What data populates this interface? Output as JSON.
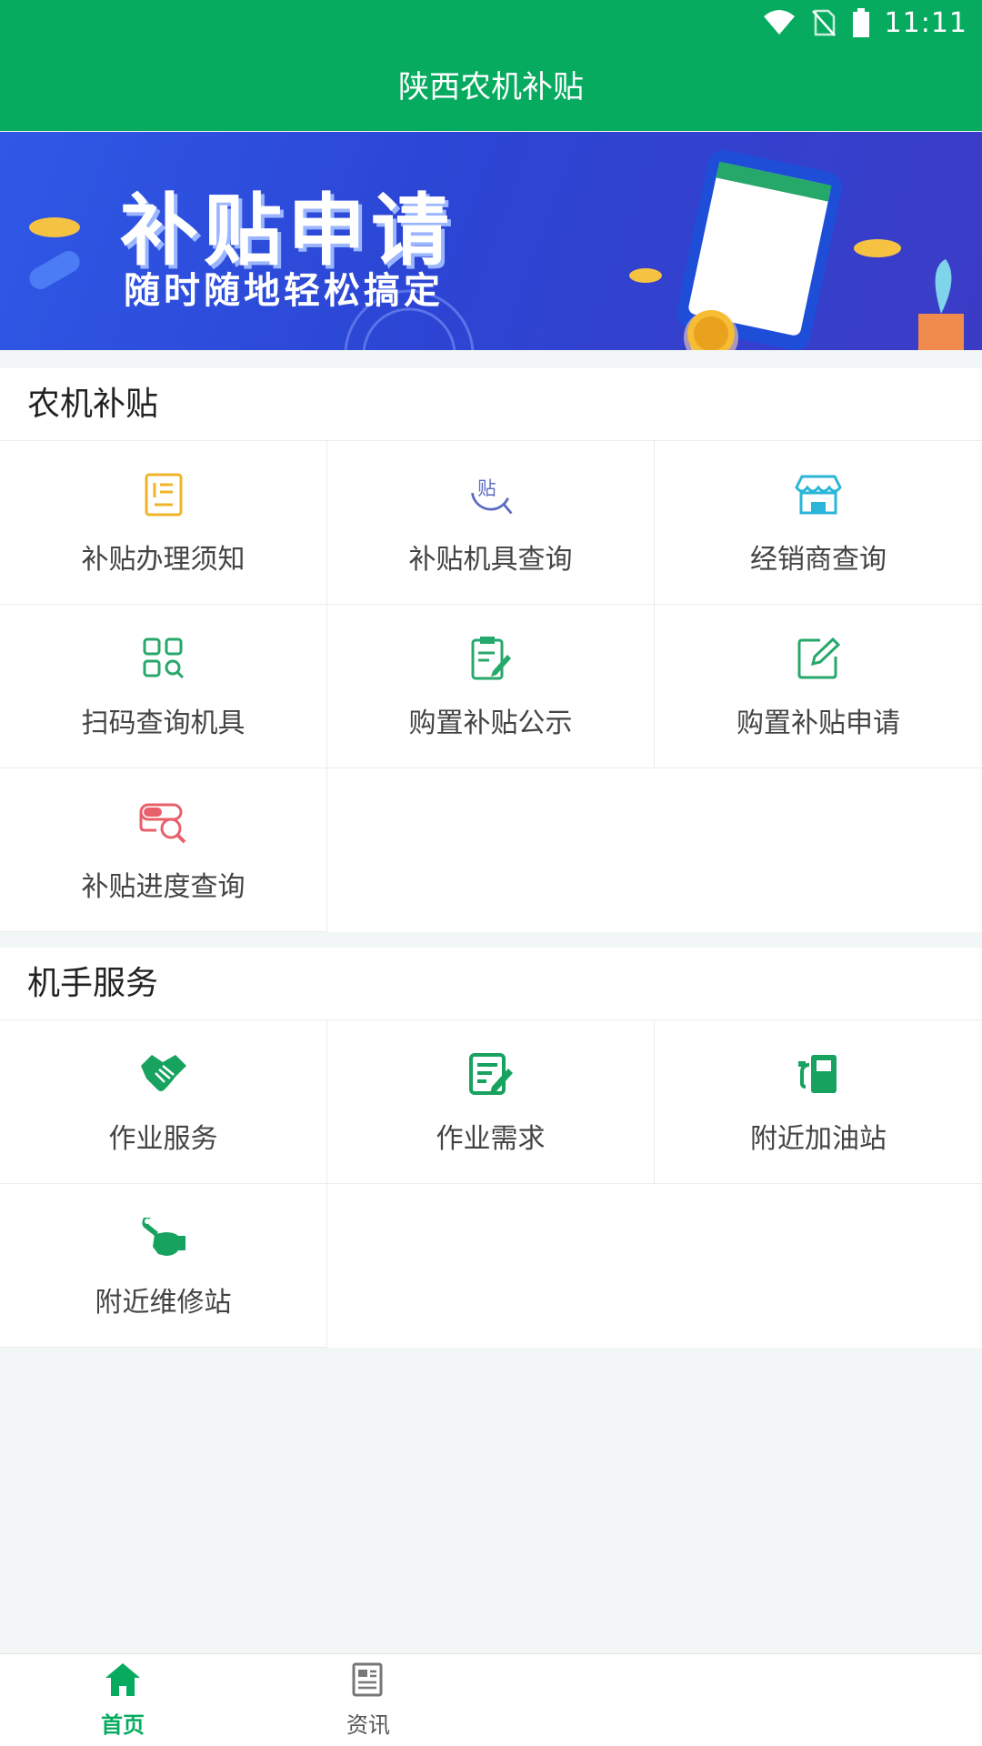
{
  "status_bar": {
    "time": "11:11"
  },
  "header": {
    "title": "陕西农机补贴"
  },
  "banner": {
    "headline": "补贴申请",
    "subline": "随时随地轻松搞定"
  },
  "subsidy": {
    "title": "农机补贴",
    "items": [
      {
        "label": "补贴办理须知",
        "icon": "document-list-icon",
        "color": "#f0b429"
      },
      {
        "label": "补贴机具查询",
        "icon": "subsidy-search-icon",
        "color": "#5c6bc0"
      },
      {
        "label": "经销商查询",
        "icon": "store-icon",
        "color": "#29b6d8"
      },
      {
        "label": "扫码查询机具",
        "icon": "scan-grid-icon",
        "color": "#27a86b"
      },
      {
        "label": "购置补贴公示",
        "icon": "clipboard-edit-icon",
        "color": "#27a86b"
      },
      {
        "label": "购置补贴申请",
        "icon": "edit-square-icon",
        "color": "#27a86b"
      },
      {
        "label": "补贴进度查询",
        "icon": "progress-search-icon",
        "color": "#e8606a"
      }
    ]
  },
  "driver": {
    "title": "机手服务",
    "items": [
      {
        "label": "作业服务",
        "icon": "handshake-icon",
        "color": "#17a35f"
      },
      {
        "label": "作业需求",
        "icon": "form-edit-icon",
        "color": "#17a35f"
      },
      {
        "label": "附近加油站",
        "icon": "fuel-pump-icon",
        "color": "#17a35f"
      },
      {
        "label": "附近维修站",
        "icon": "wrench-hand-icon",
        "color": "#17a35f"
      }
    ]
  },
  "tabs": [
    {
      "label": "首页",
      "icon": "home-icon",
      "active": true
    },
    {
      "label": "资讯",
      "icon": "news-icon",
      "active": false
    }
  ],
  "accent": "#07ab60"
}
